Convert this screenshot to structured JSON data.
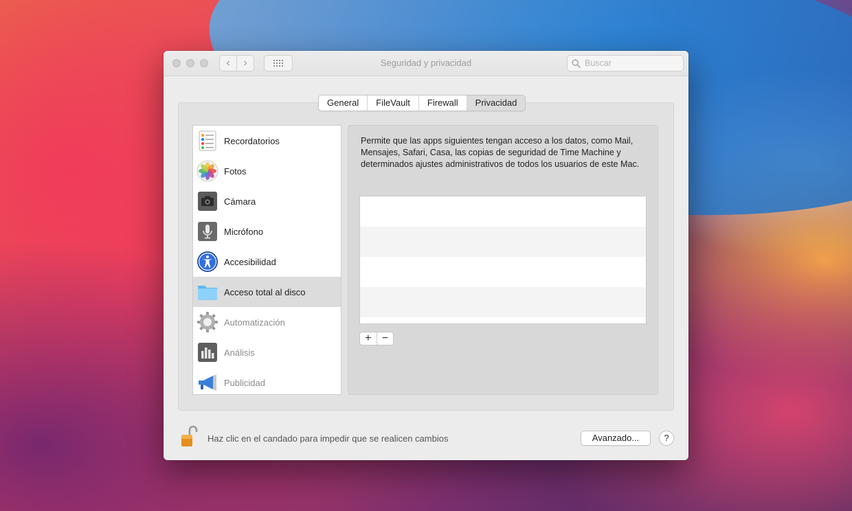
{
  "window": {
    "title": "Seguridad y privacidad",
    "search_placeholder": "Buscar",
    "nav": {
      "back": "‹",
      "forward": "›"
    }
  },
  "tabs": [
    {
      "label": "General"
    },
    {
      "label": "FileVault"
    },
    {
      "label": "Firewall"
    },
    {
      "label": "Privacidad",
      "active": true
    }
  ],
  "sidebar": {
    "selected": "Acceso total al disco",
    "items": [
      {
        "label": "Recordatorios",
        "icon": "reminders-icon"
      },
      {
        "label": "Fotos",
        "icon": "photos-icon"
      },
      {
        "label": "Cámara",
        "icon": "camera-icon"
      },
      {
        "label": "Micrófono",
        "icon": "microphone-icon"
      },
      {
        "label": "Accesibilidad",
        "icon": "accessibility-icon"
      },
      {
        "label": "Acceso total al disco",
        "icon": "folder-icon"
      },
      {
        "label": "Automatización",
        "icon": "gear-icon"
      },
      {
        "label": "Análisis",
        "icon": "analytics-icon"
      },
      {
        "label": "Publicidad",
        "icon": "megaphone-icon"
      }
    ]
  },
  "content": {
    "description": "Permite que las apps siguientes tengan acceso a los datos, como Mail, Mensajes, Safari, Casa, las copias de seguridad de Time Machine y determinados ajustes administrativos de todos los usuarios de este Mac.",
    "add_label": "+",
    "remove_label": "−"
  },
  "footer": {
    "lock_text": "Haz clic en el candado para impedir que se realicen cambios",
    "advanced_label": "Avanzado...",
    "help_label": "?"
  }
}
